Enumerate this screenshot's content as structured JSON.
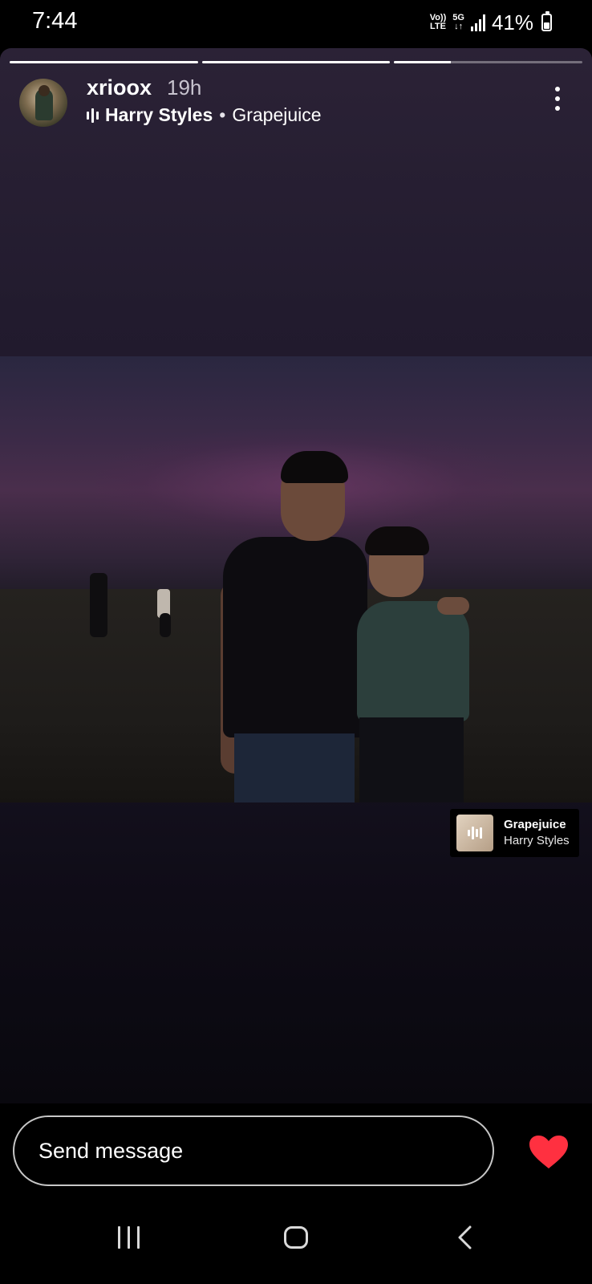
{
  "status_bar": {
    "time": "7:44",
    "volte": "Vo))",
    "lte": "LTE",
    "net": "5G",
    "net_arrows": "↓↑",
    "battery_pct": "41%"
  },
  "story": {
    "progress_segments": [
      1.0,
      1.0,
      0.3
    ],
    "username": "xrioox",
    "time_ago": "19h",
    "music": {
      "artist": "Harry Styles",
      "separator": "•",
      "song": "Grapejuice"
    }
  },
  "music_sticker": {
    "title": "Grapejuice",
    "artist": "Harry Styles"
  },
  "message_bar": {
    "placeholder": "Send message"
  },
  "icons": {
    "more": "more-vertical-icon",
    "heart": "heart-icon",
    "equalizer": "equalizer-icon",
    "recents": "recents-icon",
    "home": "home-icon",
    "back": "back-icon"
  },
  "colors": {
    "heart": "#ff3040",
    "background": "#000000"
  }
}
